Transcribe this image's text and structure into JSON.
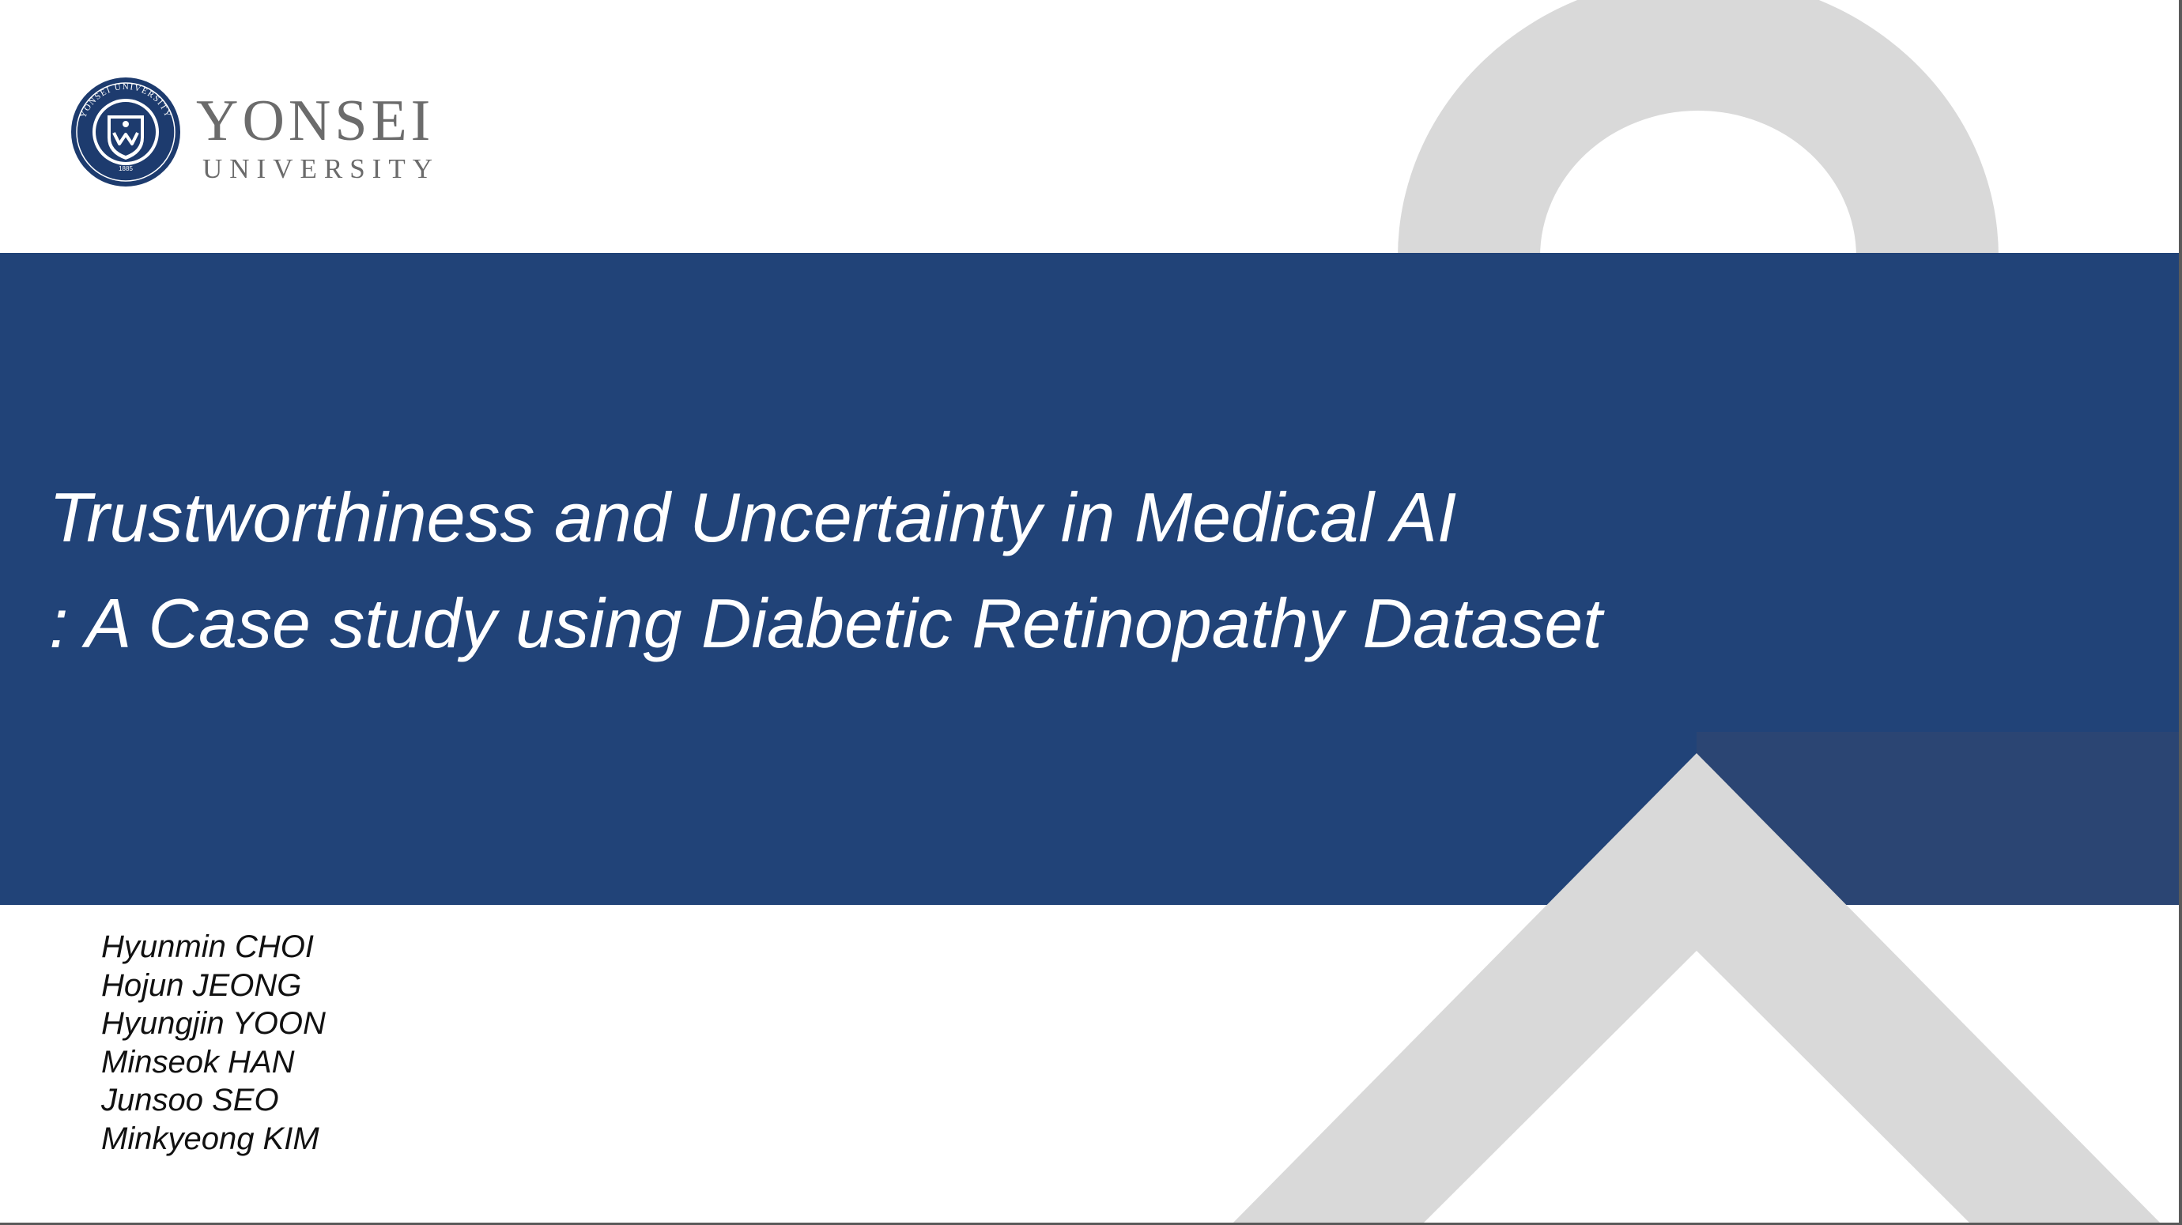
{
  "colors": {
    "banner": "#214378",
    "banner_accent": "#2b4573",
    "decor_gray": "#d9d9d9",
    "title_text": "#ffffff",
    "author_text": "#111111",
    "logo_navy": "#1d3b6e",
    "logo_gray": "#6b6b6b"
  },
  "logo": {
    "name_top": "YONSEI",
    "name_bottom": "UNIVERSITY",
    "seal_ring_text": "YONSEI UNIVERSITY",
    "seal_year": "1885",
    "icon": "yonsei-seal-icon"
  },
  "title": {
    "line1": "Trustworthiness and Uncertainty in Medical AI",
    "line2": ": A Case study using Diabetic Retinopathy Dataset"
  },
  "authors": [
    "Hyunmin CHOI",
    "Hojun JEONG",
    "Hyungjin YOON",
    "Minseok HAN",
    "Junsoo SEO",
    "Minkyeong KIM"
  ]
}
